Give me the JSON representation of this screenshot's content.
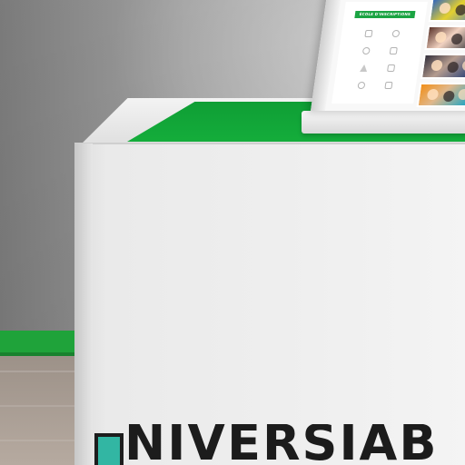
{
  "scene": {
    "colors": {
      "desk_green": "#14ad3b",
      "desk_white": "#efefef",
      "logo_teal": "#32b6a3",
      "logo_dark": "#1c1c1c",
      "wall_gray": "#a4a4a4"
    }
  },
  "brochure": {
    "heading": "ÉCOLE D'INSCRIPTIONS"
  },
  "desk": {
    "logo_text": "NIVERSIAB"
  }
}
